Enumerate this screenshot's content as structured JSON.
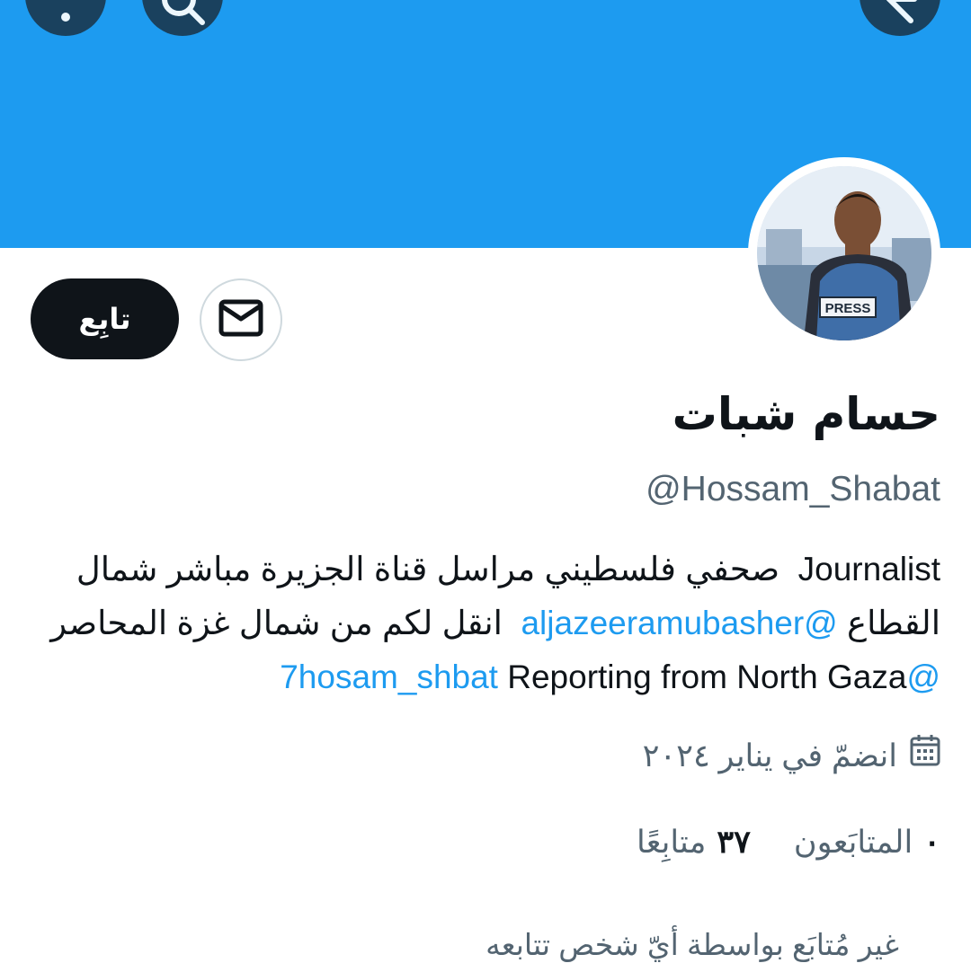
{
  "header": {
    "more_icon": "more-vertical-icon",
    "search_icon": "search-icon",
    "back_icon": "arrow-back-icon",
    "banner_color": "#1d9bf0"
  },
  "profile": {
    "avatar_icon": "profile-photo",
    "avatar_badge_text": "PRESS",
    "follow_label": "تابِع",
    "message_icon": "envelope-icon",
    "display_name": "حسام شبات",
    "handle": "@Hossam_Shabat",
    "bio": {
      "line1_a": "Journalist",
      "line1_b": "صحفي فلسطيني مراسل قناة الجزيرة مباشر شمال",
      "line2_a": "القطاع",
      "line2_link": "@aljazeeramubasher",
      "line2_b": "انقل لكم من شمال غزة المحاصر",
      "line3_link": "@7hosam_shbat",
      "line3_b": "Reporting from North Gaza"
    },
    "joined_icon": "calendar-icon",
    "joined": "انضمّ في يناير ٢٠٢٤",
    "following_count": "٣٧",
    "following_label": "متابِعًا",
    "followers_count": "٠",
    "followers_label": "المتابَعون",
    "not_followed": "غير مُتابَع بواسطة أيّ شخص تتابعه"
  },
  "colors": {
    "accent": "#1d9bf0",
    "text_primary": "#0f1419",
    "text_secondary": "#536471"
  }
}
